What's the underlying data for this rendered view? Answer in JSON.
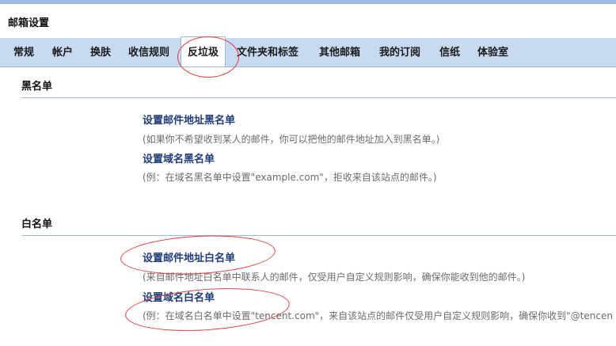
{
  "page": {
    "title": "邮箱设置"
  },
  "tabs": [
    {
      "label": "常规"
    },
    {
      "label": "帐户"
    },
    {
      "label": "换肤"
    },
    {
      "label": "收信规则"
    },
    {
      "label": "反垃圾"
    },
    {
      "label": "文件夹和标签"
    },
    {
      "label": "其他邮箱"
    },
    {
      "label": "我的订阅"
    },
    {
      "label": "信纸"
    },
    {
      "label": "体验室"
    }
  ],
  "blacklist": {
    "title": "黑名单",
    "address_link": "设置邮件地址黑名单",
    "address_desc": "(如果你不希望收到某人的邮件，你可以把他的邮件地址加入到黑名单。)",
    "domain_link": "设置域名黑名单",
    "domain_desc": "(例：在域名黑名单中设置\"example.com\"，拒收来自该站点的邮件。)"
  },
  "whitelist": {
    "title": "白名单",
    "address_link": "设置邮件地址白名单",
    "address_desc": "(来自邮件地址白名单中联系人的邮件，仅受用户自定义规则影响，确保你能收到他的邮件。)",
    "domain_link": "设置域名白名单",
    "domain_desc": "(例：在域名白名单中设置\"tencent.com\"，来自该站点的邮件仅受用户自定义规则影响，确保你收到\"@tencen"
  },
  "colors": {
    "tabbar_bg": "#c8daf1",
    "link": "#1f3d7a",
    "annotation": "#e23c3c"
  }
}
